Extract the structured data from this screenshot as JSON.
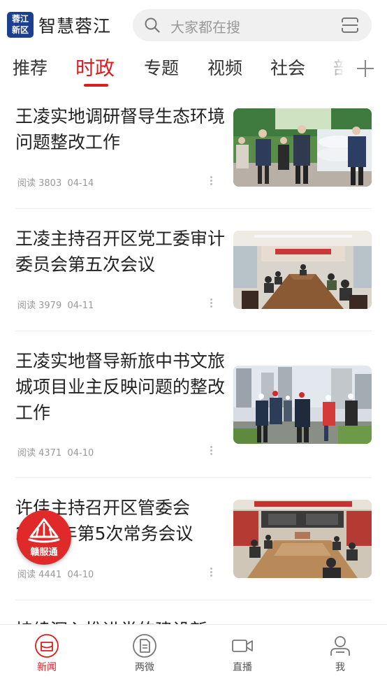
{
  "app": {
    "logo_line1": "蓉江",
    "logo_line2": "新区",
    "title": "智慧蓉江"
  },
  "search": {
    "placeholder": "大家都在搜"
  },
  "tabs": [
    {
      "label": "推荐",
      "active": false
    },
    {
      "label": "时政",
      "active": true
    },
    {
      "label": "专题",
      "active": false
    },
    {
      "label": "视频",
      "active": false
    },
    {
      "label": "社会",
      "active": false
    },
    {
      "label": "部",
      "active": false
    }
  ],
  "news": [
    {
      "title": "王凌实地调研督导生态环境问题整改工作",
      "reads": "阅读 3803",
      "date": "04-14"
    },
    {
      "title": "王凌主持召开区党工委审计委员会第五次会议",
      "reads": "阅读 3979",
      "date": "04-11"
    },
    {
      "title": "王凌实地督导新旅中书文旅城项目业主反映问题的整改工作",
      "reads": "阅读 4371",
      "date": "04-10"
    },
    {
      "title": "许佳主持召开区管委会2023年第5次常务会议",
      "reads": "阅读 4441",
      "date": "04-10"
    },
    {
      "title": "持续深入推进党的建设新",
      "reads": "",
      "date": ""
    }
  ],
  "fab": {
    "label": "赣服通"
  },
  "bottom_nav": [
    {
      "label": "新闻",
      "icon": "news-icon",
      "active": true
    },
    {
      "label": "两微",
      "icon": "document-icon",
      "active": false
    },
    {
      "label": "直播",
      "icon": "video-camera-icon",
      "active": false
    },
    {
      "label": "我",
      "icon": "user-icon",
      "active": false
    }
  ],
  "colors": {
    "accent": "#d81e1e",
    "logo_bg": "#1d3f8f",
    "fab_bg": "#e02a2a"
  }
}
